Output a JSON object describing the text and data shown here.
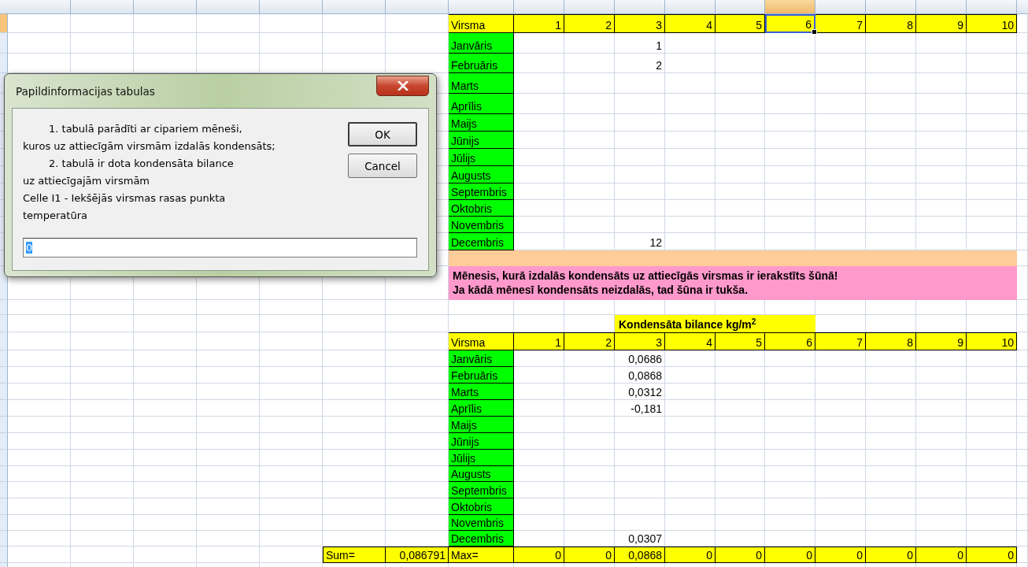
{
  "sheet": {
    "table1": {
      "header": {
        "label": "Virsma",
        "columns": [
          {
            "label": "1",
            "selected": false
          },
          {
            "label": "2",
            "selected": false
          },
          {
            "label": "3",
            "selected": false
          },
          {
            "label": "4",
            "selected": false
          },
          {
            "label": "5",
            "selected": false
          },
          {
            "label": "6",
            "selected": true
          },
          {
            "label": "7",
            "selected": false
          },
          {
            "label": "8",
            "selected": false
          },
          {
            "label": "9",
            "selected": false
          },
          {
            "label": "10",
            "selected": false
          }
        ]
      },
      "rows": [
        {
          "label": "Janvāris",
          "values": {
            "col_3": "1"
          }
        },
        {
          "label": "Februāris",
          "values": {
            "col_3": "2"
          }
        },
        {
          "label": "Marts"
        },
        {
          "label": "Aprīlis"
        },
        {
          "label": "Maijs"
        },
        {
          "label": "Jūnijs"
        },
        {
          "label": "Jūlijs"
        },
        {
          "label": "Augusts"
        },
        {
          "label": "Septembris"
        },
        {
          "label": "Oktobris"
        },
        {
          "label": "Novembris"
        },
        {
          "label": "Decembris",
          "values": {
            "col_3": "12"
          }
        }
      ]
    },
    "note": {
      "lines": [
        "Mēnesis, kurā izdalās kondensāts uz attiecīgās virsmas ir ierakstīts šūnā!",
        "Ja kādā mēnesī kondensāts neizdalās, tad šūna ir tukša."
      ]
    },
    "table2": {
      "title": "Kondensāta bilance kg/m$^{2}$",
      "header": {
        "label": "Virsma",
        "columns": [
          "1",
          "2",
          "3",
          "4",
          "5",
          "6",
          "7",
          "8",
          "9",
          "10"
        ]
      },
      "rows": [
        {
          "label": "Janvāris",
          "values": {
            "col_3": "0,0686"
          }
        },
        {
          "label": "Februāris",
          "values": {
            "col_3": "0,0868"
          }
        },
        {
          "label": "Marts",
          "values": {
            "col_3": "0,0312"
          }
        },
        {
          "label": "Aprīlis",
          "values": {
            "col_3": "-0,181"
          }
        },
        {
          "label": "Maijs"
        },
        {
          "label": "Jūnijs"
        },
        {
          "label": "Jūlijs"
        },
        {
          "label": "Augusts"
        },
        {
          "label": "Septembris"
        },
        {
          "label": "Oktobris"
        },
        {
          "label": "Novembris"
        },
        {
          "label": "Decembris",
          "values": {
            "col_3": "0,0307"
          }
        }
      ],
      "sum_label": "Sum=",
      "sum_value": "0,086791",
      "max_label": "Max=",
      "max_values": [
        "0",
        "0",
        "0,0868",
        "0",
        "0",
        "0",
        "0",
        "0",
        "0",
        "0"
      ]
    }
  },
  "dialog": {
    "title": "Papildinformacijas tabulas",
    "message": [
      {
        "text": "1. tabulā parādīti ar cipariem mēneši,",
        "indented": true
      },
      {
        "text": "kuros uz attiecīgām virsmām izdalās kondensāts;",
        "indented": false
      },
      {
        "text": "2. tabulā ir dota kondensāta bilance",
        "indented": true
      },
      {
        "text": "uz attiecīgajām virsmām",
        "indented": false
      },
      {
        "text": "Celle I1 - Iekšējās virsmas rasas punkta",
        "indented": false
      },
      {
        "text": "temperatūra",
        "indented": false
      }
    ],
    "buttons": [
      {
        "label": "OK",
        "default": true
      },
      {
        "label": "Cancel",
        "default": false
      }
    ],
    "input": {
      "value": "0",
      "text_selected": true
    }
  }
}
